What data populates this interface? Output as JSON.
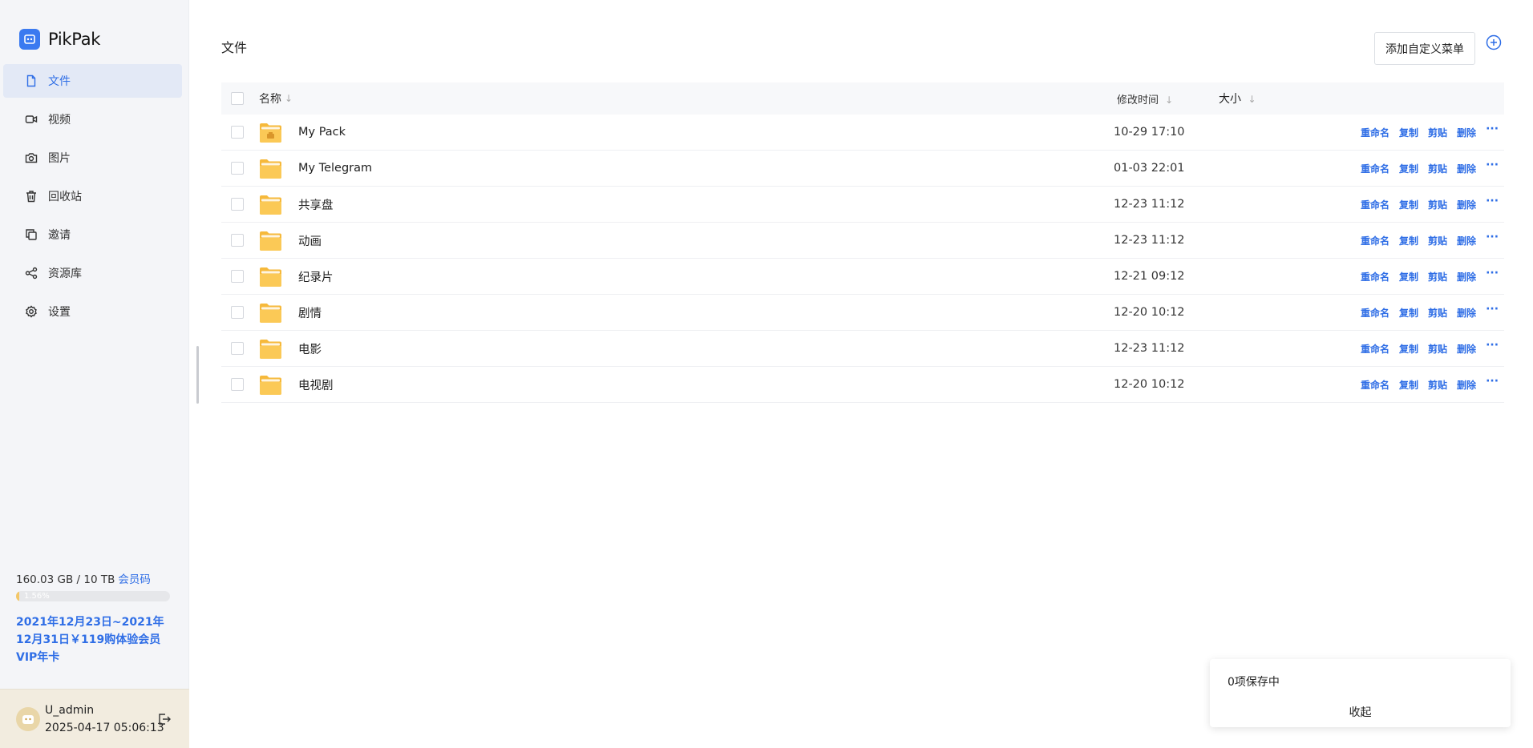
{
  "brand": {
    "name": "PikPak"
  },
  "colors": {
    "accent": "#2f6ee6",
    "folder": "#f6b93b",
    "sidebar_bg": "#f4f5f8",
    "user_bar_bg": "#f2ecdf"
  },
  "sidebar": {
    "items": [
      {
        "label": "文件",
        "icon": "file-icon",
        "active": true
      },
      {
        "label": "视频",
        "icon": "video-icon",
        "active": false
      },
      {
        "label": "图片",
        "icon": "camera-icon",
        "active": false
      },
      {
        "label": "回收站",
        "icon": "trash-icon",
        "active": false
      },
      {
        "label": "邀请",
        "icon": "copy-icon",
        "active": false
      },
      {
        "label": "资源库",
        "icon": "share-icon",
        "active": false
      },
      {
        "label": "设置",
        "icon": "gear-icon",
        "active": false
      }
    ],
    "storage": {
      "usage": "160.03 GB / 10 TB",
      "member_link": "会员码",
      "percent_label": "1.56%",
      "percent": 1.56
    },
    "promo": "2021年12月23日~2021年12月31日￥119购体验会员VIP年卡",
    "user": {
      "name": "U_admin",
      "time": "2025-04-17 05:06:13"
    }
  },
  "main": {
    "title": "文件",
    "add_menu_label": "添加自定义菜单",
    "table": {
      "headers": {
        "name": "名称",
        "mtime": "修改时间",
        "size": "大小"
      },
      "rows": [
        {
          "name": "My Pack",
          "time": "10-29 17:10",
          "special": true
        },
        {
          "name": "My Telegram",
          "time": "01-03 22:01"
        },
        {
          "name": "共享盘",
          "time": "12-23 11:12"
        },
        {
          "name": "动画",
          "time": "12-23 11:12"
        },
        {
          "name": "纪录片",
          "time": "12-21 09:12"
        },
        {
          "name": "剧情",
          "time": "12-20 10:12"
        },
        {
          "name": "电影",
          "time": "12-23 11:12"
        },
        {
          "name": "电视剧",
          "time": "12-20 10:12"
        }
      ],
      "actions": {
        "rename": "重命名",
        "copy": "复制",
        "cut": "剪贴",
        "delete": "删除",
        "more": "···"
      }
    }
  },
  "save_panel": {
    "status": "0项保存中",
    "collapse": "收起"
  }
}
